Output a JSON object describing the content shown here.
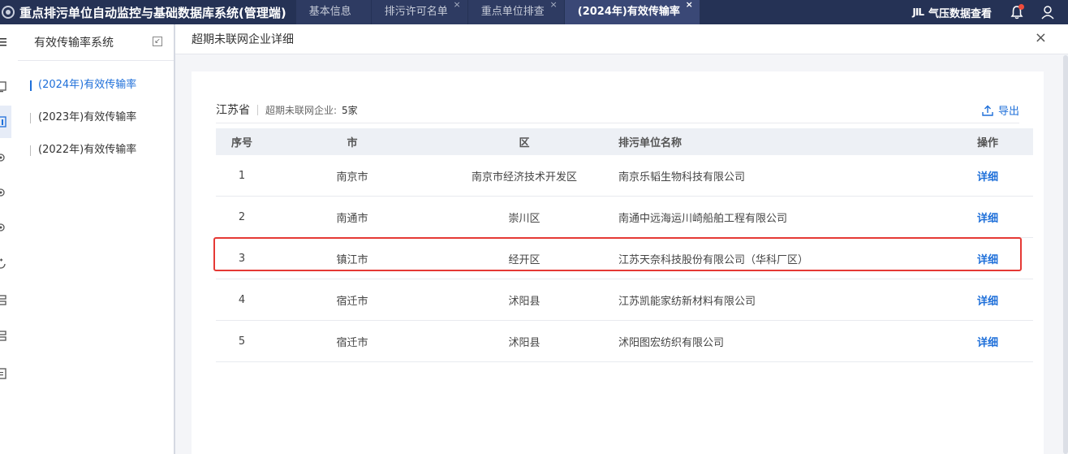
{
  "header": {
    "title": "重点排污单位自动监控与基础数据库系统(管理端)",
    "tabs": [
      {
        "label": "基本信息",
        "closable": false,
        "active": false
      },
      {
        "label": "排污许可名单",
        "closable": true,
        "active": false
      },
      {
        "label": "重点单位排查",
        "closable": true,
        "active": false
      },
      {
        "label": "(2024年)有效传输率",
        "closable": true,
        "active": true
      }
    ],
    "close_glyph": "×",
    "weather_icon_text": "JIL",
    "weather_label": "气压数据查看",
    "notification_badge": true
  },
  "submenu": {
    "title": "有效传输率系统",
    "items": [
      {
        "label": "(2024年)有效传输率",
        "active": true
      },
      {
        "label": "(2023年)有效传输率",
        "active": false
      },
      {
        "label": "(2022年)有效传输率",
        "active": false
      }
    ]
  },
  "panel": {
    "title": "超期未联网企业详细",
    "close_glyph": "×",
    "province": "江苏省",
    "count_label": "超期未联网企业:",
    "count_value": "5家",
    "export_label": "导出",
    "table": {
      "columns": [
        "序号",
        "市",
        "区",
        "排污单位名称",
        "操作"
      ],
      "rows": [
        {
          "idx": "1",
          "city": "南京市",
          "district": "南京市经济技术开发区",
          "name": "南京乐韬生物科技有限公司",
          "action": "详细"
        },
        {
          "idx": "2",
          "city": "南通市",
          "district": "崇川区",
          "name": "南通中远海运川崎船舶工程有限公司",
          "action": "详细"
        },
        {
          "idx": "3",
          "city": "镇江市",
          "district": "经开区",
          "name": "江苏天奈科技股份有限公司（华科厂区）",
          "action": "详细"
        },
        {
          "idx": "4",
          "city": "宿迁市",
          "district": "沭阳县",
          "name": "江苏凯能家纺新材料有限公司",
          "action": "详细"
        },
        {
          "idx": "5",
          "city": "宿迁市",
          "district": "沭阳县",
          "name": "沭阳图宏纺织有限公司",
          "action": "详细"
        }
      ],
      "highlighted_row": 3
    }
  },
  "colors": {
    "header_bg": "#253255",
    "accent": "#1e6fd9",
    "highlight_border": "#e53935"
  }
}
